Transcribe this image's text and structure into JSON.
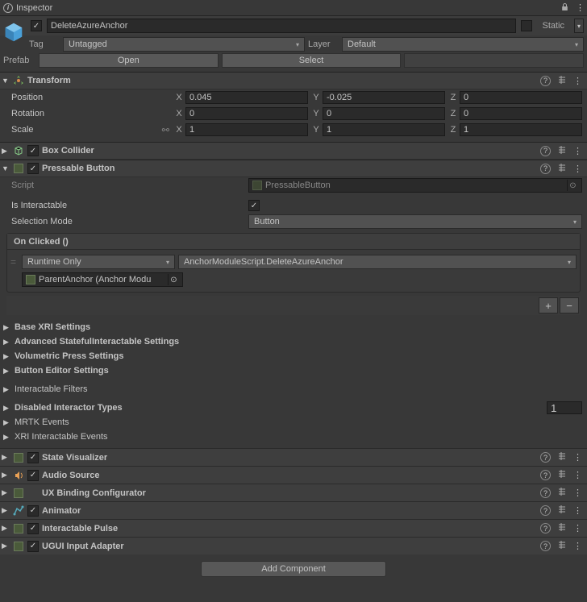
{
  "window": {
    "title": "Inspector"
  },
  "gameObject": {
    "name": "DeleteAzureAnchor",
    "active": true,
    "static": false,
    "tag_label": "Tag",
    "tag_value": "Untagged",
    "layer_label": "Layer",
    "layer_value": "Default",
    "prefab_label": "Prefab",
    "open_btn": "Open",
    "select_btn": "Select"
  },
  "transform": {
    "title": "Transform",
    "position_label": "Position",
    "rotation_label": "Rotation",
    "scale_label": "Scale",
    "position": {
      "x": "0.045",
      "y": "-0.025",
      "z": "0"
    },
    "rotation": {
      "x": "0",
      "y": "0",
      "z": "0"
    },
    "scale": {
      "x": "1",
      "y": "1",
      "z": "1"
    }
  },
  "boxCollider": {
    "title": "Box Collider"
  },
  "pressable": {
    "title": "Pressable Button",
    "script_label": "Script",
    "script_value": "PressableButton",
    "is_interactable_label": "Is Interactable",
    "is_interactable": true,
    "selection_mode_label": "Selection Mode",
    "selection_mode_value": "Button",
    "onclicked_label": "On Clicked ()",
    "runtime_value": "Runtime Only",
    "method_value": "AnchorModuleScript.DeleteAzureAnchor",
    "target_object": "ParentAnchor (Anchor Modu"
  },
  "subSections": {
    "base_xri": "Base XRI Settings",
    "adv_stateful": "Advanced StatefulInteractable Settings",
    "volumetric": "Volumetric Press Settings",
    "button_editor": "Button Editor Settings",
    "interactable_filters": "Interactable Filters",
    "disabled_interactor": "Disabled Interactor Types",
    "disabled_count": "1",
    "mrtk_events": "MRTK Events",
    "xri_events": "XRI Interactable Events"
  },
  "components": {
    "state_visualizer": "State Visualizer",
    "audio_source": "Audio Source",
    "ux_binding": "UX Binding Configurator",
    "animator": "Animator",
    "interactable_pulse": "Interactable Pulse",
    "ugui_adapter": "UGUI Input Adapter"
  },
  "footer": {
    "add_component": "Add Component"
  },
  "labels": {
    "static": "Static",
    "x": "X",
    "y": "Y",
    "z": "Z"
  },
  "colors": {
    "bg": "#383838",
    "text": "#c4c4c4"
  }
}
